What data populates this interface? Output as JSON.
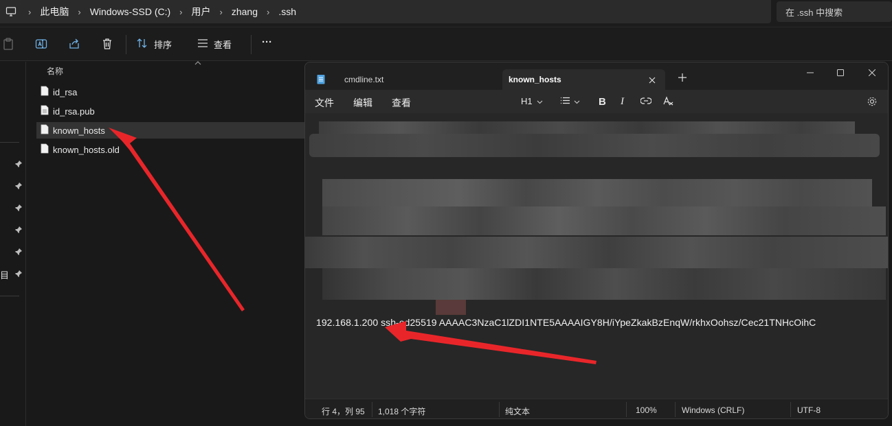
{
  "explorer": {
    "breadcrumb": [
      "此电脑",
      "Windows-SSD (C:)",
      "用户",
      "zhang",
      ".ssh"
    ],
    "search_placeholder": "在 .ssh 中搜索",
    "toolbar": {
      "sort_label": "排序",
      "view_label": "查看",
      "more_label": "···"
    },
    "column_header": "名称",
    "nav_fragment": "目",
    "files": [
      {
        "name": "id_rsa",
        "selected": false
      },
      {
        "name": "id_rsa.pub",
        "selected": false
      },
      {
        "name": "known_hosts",
        "selected": true
      },
      {
        "name": "known_hosts.old",
        "selected": false
      }
    ]
  },
  "notepad": {
    "tabs": [
      {
        "label": "cmdline.txt",
        "active": false
      },
      {
        "label": "known_hosts",
        "active": true
      }
    ],
    "menu": {
      "file": "文件",
      "edit": "编辑",
      "view": "查看"
    },
    "format": {
      "heading": "H1",
      "bold": "B",
      "italic": "I"
    },
    "content_line": "192.168.1.200 ssh-ed25519 AAAAC3NzaC1lZDI1NTE5AAAAIGY8H/iYpeZkakBzEnqW/rkhxOohsz/Cec21TNHcOihC",
    "status": {
      "position": "行 4，列 95",
      "chars": "1,018 个字符",
      "format": "纯文本",
      "zoom": "100%",
      "eol": "Windows (CRLF)",
      "encoding": "UTF-8"
    }
  },
  "colors": {
    "arrow": "#e8262a",
    "background": "#191919",
    "notepad_editor": "#272727",
    "selected_row": "#333333"
  }
}
